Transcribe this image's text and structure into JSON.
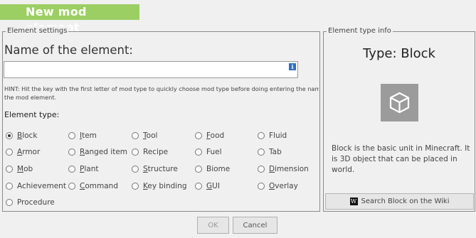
{
  "header": {
    "title": "New mod element"
  },
  "settings": {
    "legend": "Element settings",
    "name_label": "Name of the element:",
    "name_value": "",
    "info_icon": "i",
    "hint_line1": "HINT: Hit the key with the first letter of mod type to quickly choose mod type before doing entering the name o",
    "hint_line2": "the mod element.",
    "type_label": "Element type:",
    "types": [
      {
        "label": "Block",
        "mnemonic": "B",
        "checked": true
      },
      {
        "label": "Item",
        "mnemonic": "I",
        "checked": false
      },
      {
        "label": "Tool",
        "mnemonic": "T",
        "checked": false
      },
      {
        "label": "Food",
        "mnemonic": "F",
        "checked": false
      },
      {
        "label": "Fluid",
        "mnemonic": "",
        "checked": false
      },
      {
        "label": "Armor",
        "mnemonic": "A",
        "checked": false
      },
      {
        "label": "Ranged item",
        "mnemonic": "R",
        "checked": false
      },
      {
        "label": "Recipe",
        "mnemonic": "",
        "checked": false
      },
      {
        "label": "Fuel",
        "mnemonic": "",
        "checked": false
      },
      {
        "label": "Tab",
        "mnemonic": "",
        "checked": false
      },
      {
        "label": "Mob",
        "mnemonic": "M",
        "checked": false
      },
      {
        "label": "Plant",
        "mnemonic": "P",
        "checked": false
      },
      {
        "label": "Structure",
        "mnemonic": "S",
        "checked": false
      },
      {
        "label": "Biome",
        "mnemonic": "",
        "checked": false
      },
      {
        "label": "Dimension",
        "mnemonic": "D",
        "checked": false
      },
      {
        "label": "Achievement",
        "mnemonic": "",
        "checked": false
      },
      {
        "label": "Command",
        "mnemonic": "C",
        "checked": false
      },
      {
        "label": "Key binding",
        "mnemonic": "K",
        "checked": false
      },
      {
        "label": "GUI",
        "mnemonic": "G",
        "checked": false
      },
      {
        "label": "Overlay",
        "mnemonic": "O",
        "checked": false
      },
      {
        "label": "Procedure",
        "mnemonic": "",
        "checked": false
      }
    ]
  },
  "type_info": {
    "legend": "Element type info",
    "title": "Type: Block",
    "preview_icon": "cube-icon",
    "description": "Block is the basic unit in Minecraft. It is 3D object that can be placed in world.",
    "wiki_icon": "W",
    "wiki_button": "Search Block on the Wiki"
  },
  "buttons": {
    "ok": "OK",
    "cancel": "Cancel"
  },
  "colors": {
    "title_bar": "#9ccf63",
    "preview_bg": "#9b9b9b"
  }
}
